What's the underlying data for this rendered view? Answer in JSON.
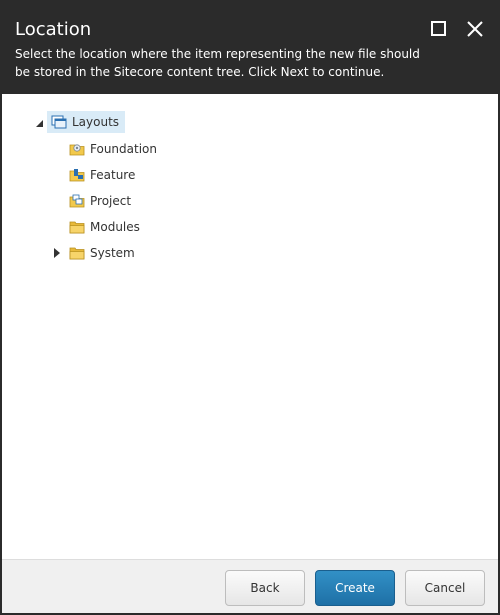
{
  "dialog": {
    "title": "Location",
    "description": "Select the location where the item representing the new file should be stored in the Sitecore content tree. Click Next to continue."
  },
  "window_controls": {
    "maximize_icon": "maximize-icon",
    "close_icon": "close-icon"
  },
  "tree": {
    "root": {
      "label": "Layouts",
      "expanded": true,
      "selected": true,
      "icon": "layouts-icon"
    },
    "children": [
      {
        "label": "Foundation",
        "icon": "foundation-folder-icon",
        "expandable": false
      },
      {
        "label": "Feature",
        "icon": "feature-folder-icon",
        "expandable": false
      },
      {
        "label": "Project",
        "icon": "project-folder-icon",
        "expandable": false
      },
      {
        "label": "Modules",
        "icon": "folder-icon",
        "expandable": false
      },
      {
        "label": "System",
        "icon": "folder-icon",
        "expandable": true,
        "expanded": false
      }
    ]
  },
  "footer": {
    "back_label": "Back",
    "create_label": "Create",
    "cancel_label": "Cancel"
  },
  "colors": {
    "header_bg": "#2b2b2b",
    "selected_bg": "#d9ebf7",
    "primary_button": "#2680b8",
    "folder_yellow": "#f2c94c"
  }
}
